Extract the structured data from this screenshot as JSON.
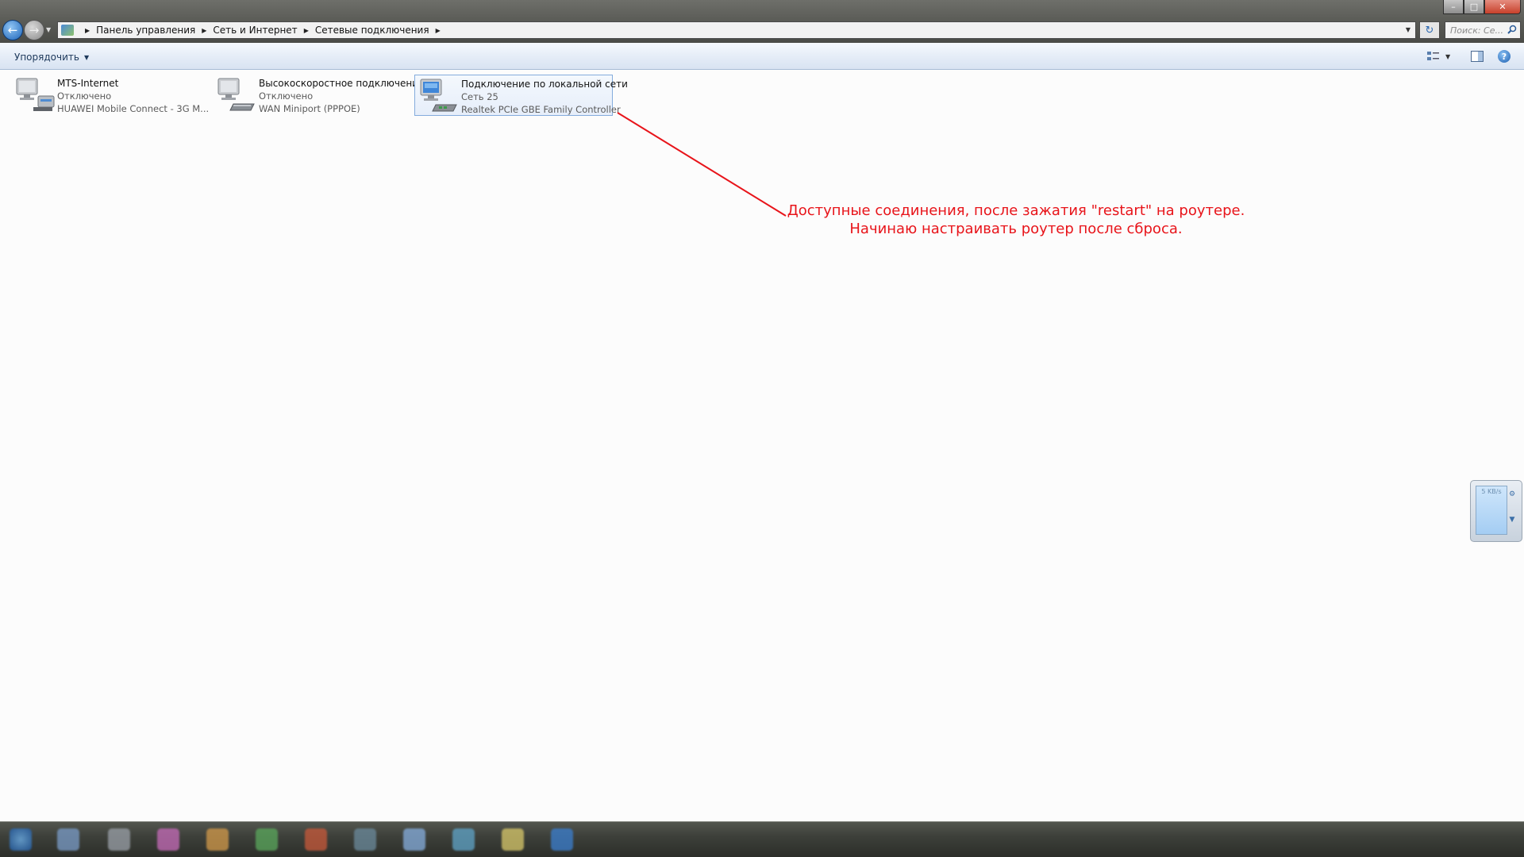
{
  "window": {
    "caption_buttons": [
      "minimize",
      "maximize",
      "close"
    ]
  },
  "address": {
    "breadcrumbs": [
      "Панель управления",
      "Сеть и Интернет",
      "Сетевые подключения"
    ],
    "search_placeholder": "Поиск: Се..."
  },
  "toolbar": {
    "organize_label": "Упорядочить",
    "help_label": "?"
  },
  "connections": [
    {
      "name": "MTS-Internet",
      "status": "Отключено",
      "device": "HUAWEI Mobile Connect - 3G M...",
      "icon": "modem-connection-icon",
      "selected": false
    },
    {
      "name": "Высокоскоростное подключение",
      "status": "Отключено",
      "device": "WAN Miniport (PPPOE)",
      "icon": "broadband-connection-icon",
      "selected": false
    },
    {
      "name": "Подключение по локальной сети",
      "status": "Сеть  25",
      "device": "Realtek PCIe GBE Family Controller",
      "icon": "lan-connection-icon",
      "selected": true
    }
  ],
  "annotation": {
    "line1": "Доступные соединения, после зажатия \"restart\" на роутере.",
    "line2": "Начинаю настраивать роутер после сброса.",
    "color": "#e8141a"
  },
  "net_widget": {
    "speed": "5 KB/s"
  },
  "colors": {
    "accent": "#1e64b8",
    "selection_border": "#84acdd",
    "annotation": "#e8141a"
  }
}
